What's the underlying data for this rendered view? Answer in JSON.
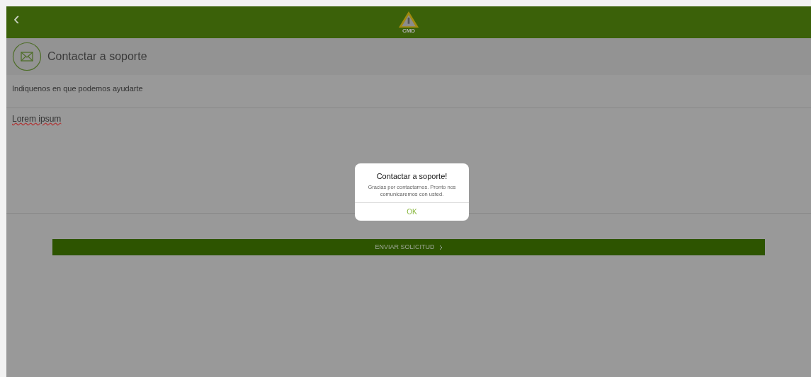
{
  "top_bar": {
    "back": "‹",
    "logo_text": "CMD"
  },
  "section_header": {
    "title": "Contactar a soporte"
  },
  "form": {
    "label": "Indiquenos en que podemos ayudarte",
    "message": "Lorem ipsum",
    "submit": "ENVIAR SOLICITUD"
  },
  "dialog": {
    "title": "Contactar a soporte!",
    "message": "Gracias por contactarnos. Pronto nos comunicaremos con usted.",
    "button": "OK"
  }
}
